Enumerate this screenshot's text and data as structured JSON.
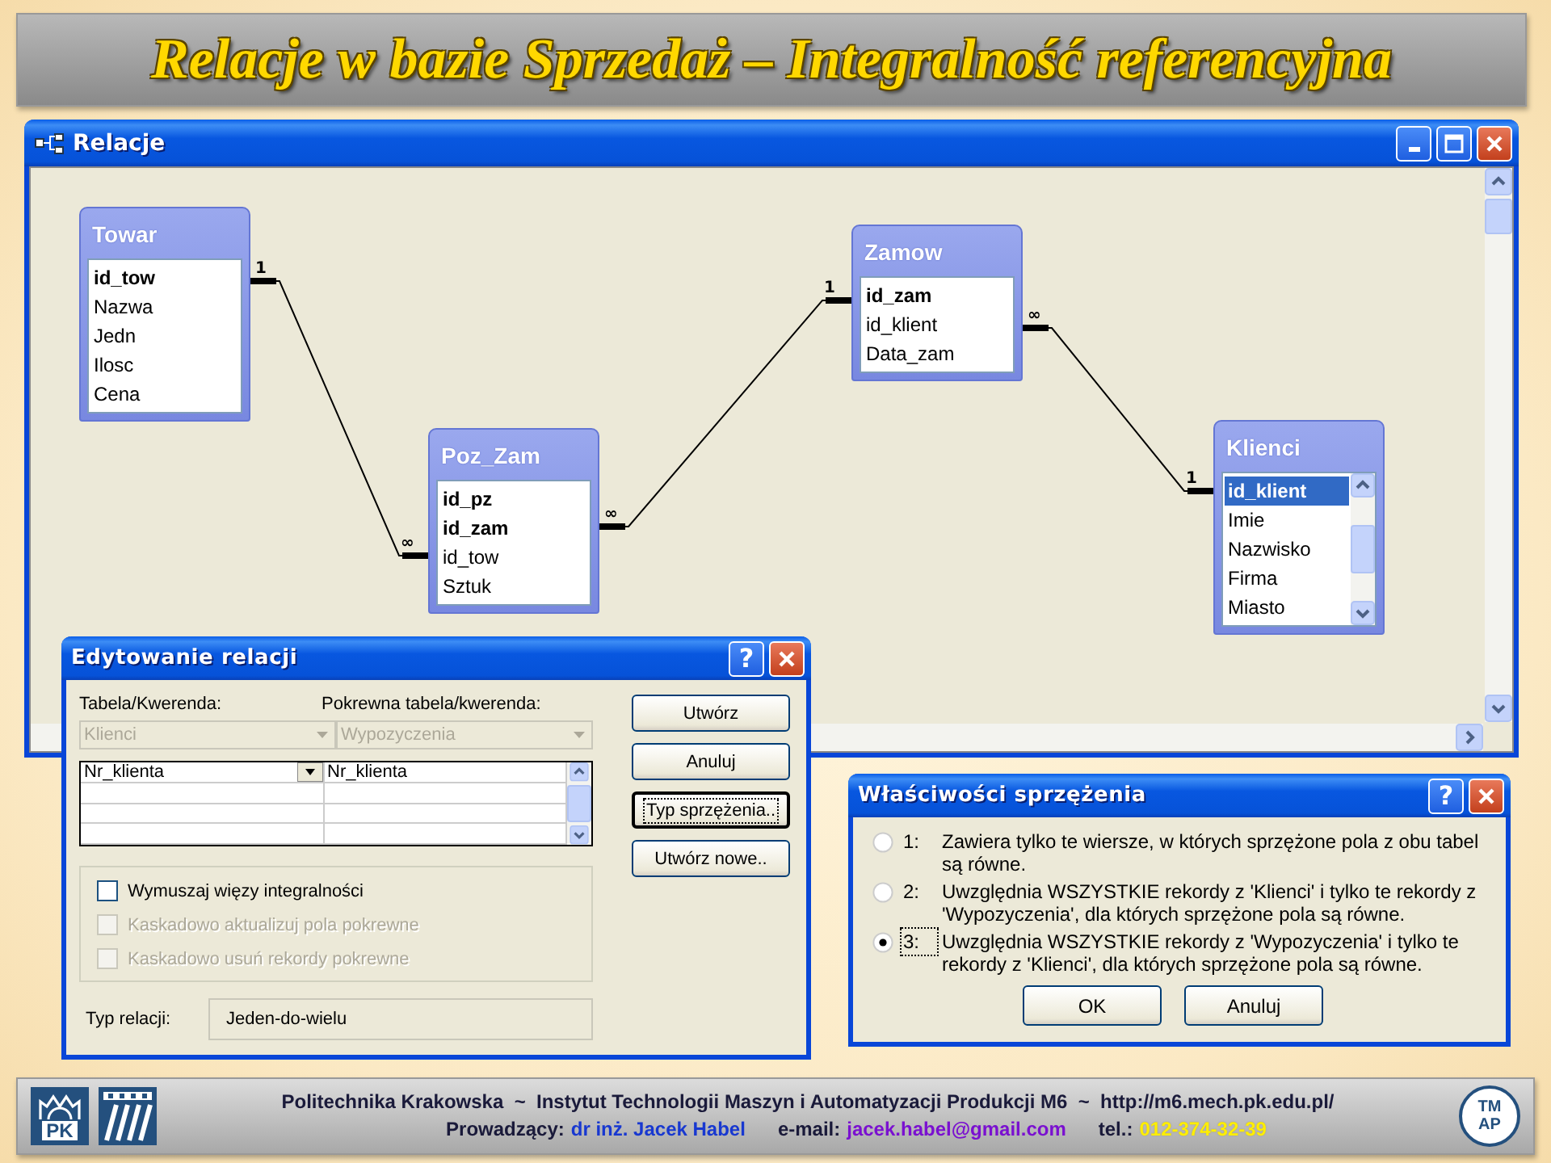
{
  "slide_title": "Relacje w bazie Sprzedaż – Integralność referencyjna",
  "relationships_window": {
    "title": "Relacje",
    "tables": [
      {
        "name": "Towar",
        "scrollable": false,
        "fields": [
          {
            "name": "id_tow",
            "key": true,
            "selected": false
          },
          {
            "name": "Nazwa",
            "key": false,
            "selected": false
          },
          {
            "name": "Jedn",
            "key": false,
            "selected": false
          },
          {
            "name": "Ilosc",
            "key": false,
            "selected": false
          },
          {
            "name": "Cena",
            "key": false,
            "selected": false
          }
        ]
      },
      {
        "name": "Poz_Zam",
        "scrollable": false,
        "fields": [
          {
            "name": "id_pz",
            "key": true,
            "selected": false
          },
          {
            "name": "id_zam",
            "key": true,
            "selected": false
          },
          {
            "name": "id_tow",
            "key": false,
            "selected": false
          },
          {
            "name": "Sztuk",
            "key": false,
            "selected": false
          }
        ]
      },
      {
        "name": "Zamow",
        "scrollable": false,
        "fields": [
          {
            "name": "id_zam",
            "key": true,
            "selected": false
          },
          {
            "name": "id_klient",
            "key": false,
            "selected": false
          },
          {
            "name": "Data_zam",
            "key": false,
            "selected": false
          }
        ]
      },
      {
        "name": "Klienci",
        "scrollable": true,
        "fields": [
          {
            "name": "id_klient",
            "key": true,
            "selected": true
          },
          {
            "name": "Imie",
            "key": false,
            "selected": false
          },
          {
            "name": "Nazwisko",
            "key": false,
            "selected": false
          },
          {
            "name": "Firma",
            "key": false,
            "selected": false
          },
          {
            "name": "Miasto",
            "key": false,
            "selected": false
          }
        ]
      }
    ],
    "relationships": [
      {
        "start_label": "1",
        "end_label": "∞"
      },
      {
        "start_label": "∞",
        "end_label": "1"
      },
      {
        "start_label": "∞",
        "end_label": "1"
      }
    ]
  },
  "edit_dialog": {
    "title": "Edytowanie relacji",
    "help_button": "?",
    "table_label": "Tabela/Kwerenda:",
    "related_label": "Pokrewna tabela/kwerenda:",
    "table_combo": {
      "value": "Klienci",
      "disabled": true
    },
    "related_combo": {
      "value": "Wypozyczenia",
      "disabled": true
    },
    "rows": [
      {
        "left": "Nr_klienta",
        "right": "Nr_klienta"
      }
    ],
    "checkboxes": [
      {
        "label": "Wymuszaj więzy integralności",
        "checked": false,
        "disabled": false
      },
      {
        "label": "Kaskadowo aktualizuj pola pokrewne",
        "checked": false,
        "disabled": true
      },
      {
        "label": "Kaskadowo usuń rekordy pokrewne",
        "checked": false,
        "disabled": true
      }
    ],
    "relation_type_label": "Typ relacji:",
    "relation_type": "Jeden-do-wielu",
    "buttons": [
      {
        "label": "Utwórz",
        "focused": false
      },
      {
        "label": "Anuluj",
        "focused": false
      },
      {
        "label": "Typ sprzężenia..",
        "focused": true
      },
      {
        "label": "Utwórz nowe..",
        "focused": false
      }
    ]
  },
  "join_dialog": {
    "title": "Właściwości sprzężenia",
    "help_button": "?",
    "options": [
      {
        "number": "1:",
        "text": "Zawiera tylko te wiersze, w których sprzężone pola z obu tabel są równe.",
        "selected": false
      },
      {
        "number": "2:",
        "text": "Uwzględnia WSZYSTKIE rekordy z 'Klienci' i tylko te rekordy z 'Wypozyczenia', dla których sprzężone pola są równe.",
        "selected": false
      },
      {
        "number": "3:",
        "text": "Uwzględnia WSZYSTKIE rekordy z 'Wypozyczenia' i tylko te rekordy z 'Klienci', dla których sprzężone pola są równe.",
        "selected": true
      }
    ],
    "buttons": [
      "OK",
      "Anuluj"
    ]
  },
  "footer": {
    "line": "Politechnika Krakowska  ~  Instytut Technologii Maszyn i Automatyzacji Produkcji M6  ~  http://m6.mech.pk.edu.pl/",
    "lecturer_label": "Prowadzący:",
    "lecturer": "dr inż. Jacek Habel",
    "email_label": "e-mail:",
    "email": "jacek.habel@gmail.com",
    "phone_label": "tel.:",
    "phone": "012-374-32-39",
    "left_logo_text": "PK",
    "right_logo_lines": [
      "TM",
      "AP"
    ]
  }
}
